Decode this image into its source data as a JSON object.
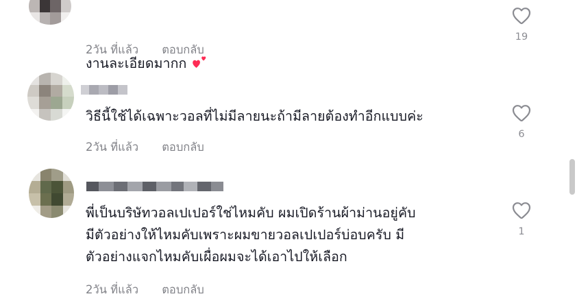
{
  "comments": [
    {
      "text": "งานละเอียดมากก",
      "time": "2วัน ที่แล้ว",
      "reply": "ตอบกลับ",
      "likes": "19",
      "emoji": "two-hearts-emoji"
    },
    {
      "text": "วิธีนี้ใช้ได้เฉพาะวอลที่ไม่มีลายนะถ้ามีลายต้องทำอีกแบบค่ะ",
      "time": "2วัน ที่แล้ว",
      "reply": "ตอบกลับ",
      "likes": "6"
    },
    {
      "text": "พี่เป็นบริษัทวอลเปเปอร์ใช่ไหมคับ ผมเปิดร้านผ้าม่านอยู่คับ\nมีตัวอย่างให้ไหมคับเพราะผมขายวอลเปเปอร์บ่อบครับ มี\nตัวอย่างแจกไหมคับเผื่อผมจะได้เอาไปให้เลือก",
      "time": "2วัน ที่แล้ว",
      "reply": "ตอบกลับ",
      "likes": "1"
    }
  ],
  "icons": {
    "like": "heart-outline-icon"
  },
  "colors": {
    "text": "#161823",
    "meta": "#8a8b91",
    "emoji": "#fe2c55"
  }
}
